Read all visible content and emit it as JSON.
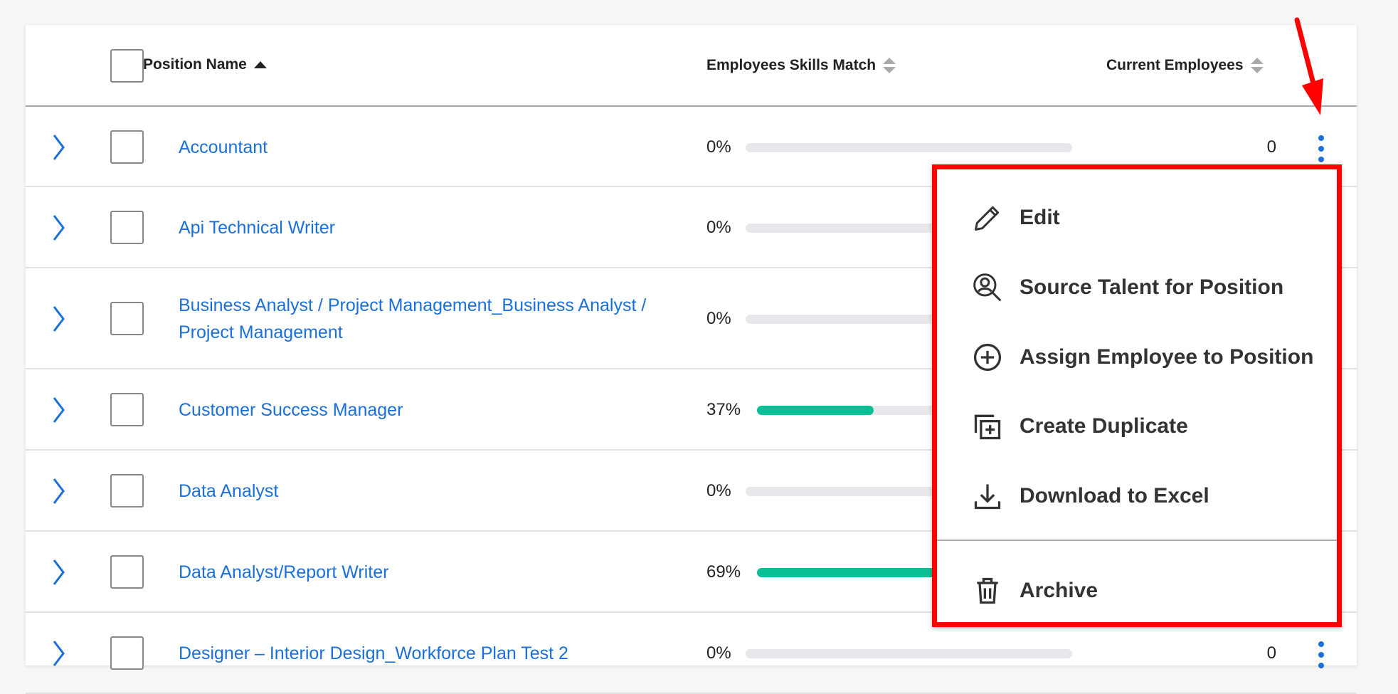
{
  "table": {
    "headers": {
      "position_name": "Position Name",
      "skills_match": "Employees Skills Match",
      "current_employees": "Current Employees"
    },
    "sort": {
      "column": "position_name",
      "direction": "ascending"
    },
    "rows": [
      {
        "name": "Accountant",
        "skills_match": "0%",
        "match_value": 0,
        "employees": "0"
      },
      {
        "name": "Api Technical Writer",
        "skills_match": "0%",
        "match_value": 0,
        "employees": ""
      },
      {
        "name": "Business Analyst / Project Management_Business Analyst / Project Management",
        "skills_match": "0%",
        "match_value": 0,
        "employees": ""
      },
      {
        "name": "Customer Success Manager",
        "skills_match": "37%",
        "match_value": 37,
        "employees": ""
      },
      {
        "name": "Data Analyst",
        "skills_match": "0%",
        "match_value": 0,
        "employees": ""
      },
      {
        "name": "Data Analyst/Report Writer",
        "skills_match": "69%",
        "match_value": 69,
        "employees": ""
      },
      {
        "name": "Designer – Interior Design_Workforce Plan Test 2",
        "skills_match": "0%",
        "match_value": 0,
        "employees": "0"
      }
    ]
  },
  "context_menu": {
    "items": [
      {
        "label": "Edit",
        "icon": "pencil-icon"
      },
      {
        "label": "Source Talent for Position",
        "icon": "search-person-icon"
      },
      {
        "label": "Assign Employee to Position",
        "icon": "plus-circle-icon"
      },
      {
        "label": "Create Duplicate",
        "icon": "duplicate-icon"
      },
      {
        "label": "Download to Excel",
        "icon": "download-icon"
      },
      {
        "label": "Archive",
        "icon": "trash-icon"
      }
    ]
  },
  "colors": {
    "link": "#1a6fd8",
    "progress": "#0abf95",
    "highlight": "#ff0000"
  }
}
